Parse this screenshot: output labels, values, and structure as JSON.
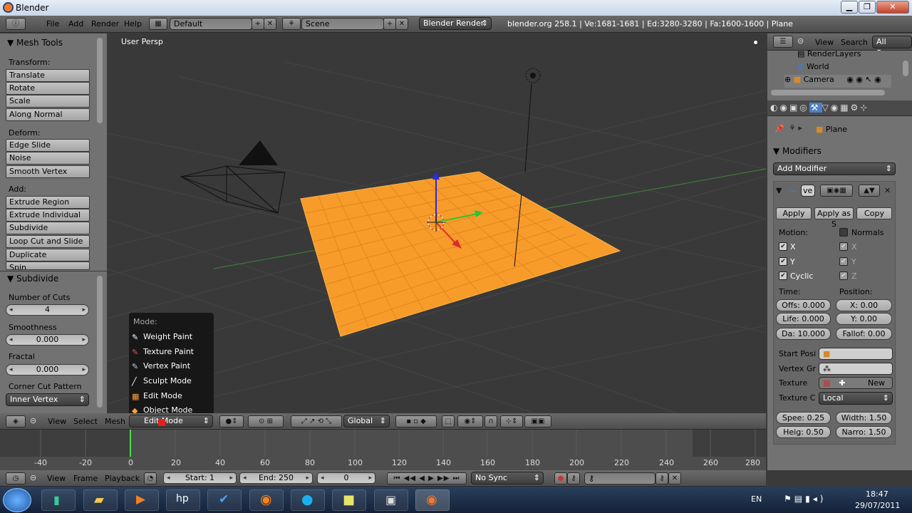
{
  "window": {
    "title": "Blender"
  },
  "topbar": {
    "menus": [
      "File",
      "Add",
      "Render",
      "Help"
    ],
    "layout": "Default",
    "scene": "Scene",
    "engine": "Blender Render",
    "stats": "blender.org 258.1 | Ve:1681-1681 | Ed:3280-3280 | Fa:1600-1600 | Plane"
  },
  "outliner": {
    "view": "View",
    "search": "Search",
    "filter": "All Scenes",
    "items": [
      "RenderLayers",
      "World",
      "Camera"
    ]
  },
  "toolshelf": {
    "title": "Mesh Tools",
    "transform_label": "Transform:",
    "transform": [
      "Translate",
      "Rotate",
      "Scale",
      "Along Normal"
    ],
    "deform_label": "Deform:",
    "deform": [
      "Edge Slide",
      "Noise",
      "Smooth Vertex"
    ],
    "add_label": "Add:",
    "add": [
      "Extrude Region",
      "Extrude Individual",
      "Subdivide",
      "Loop Cut and Slide",
      "Duplicate",
      "Spin"
    ]
  },
  "subdivide": {
    "title": "Subdivide",
    "cuts_label": "Number of Cuts",
    "cuts": "4",
    "smooth_label": "Smoothness",
    "smooth": "0.000",
    "fractal_label": "Fractal",
    "fractal": "0.000",
    "pattern_label": "Corner Cut Pattern",
    "pattern": "Inner Vertex"
  },
  "viewport": {
    "label": "User Persp"
  },
  "mode_menu": {
    "header": "Mode:",
    "items": [
      "Weight Paint",
      "Texture Paint",
      "Vertex Paint",
      "Sculpt Mode",
      "Edit Mode",
      "Object Mode"
    ]
  },
  "view3d_header": {
    "menus": [
      "View",
      "Select",
      "Mesh"
    ],
    "mode": "Edit Mode",
    "orientation": "Global"
  },
  "properties": {
    "object": "Plane",
    "modifiers_title": "Modifiers",
    "add_modifier": "Add Modifier",
    "mod_name": "ve",
    "apply": "Apply",
    "apply_as": "Apply as S",
    "copy": "Copy",
    "motion_label": "Motion:",
    "normals": "Normals",
    "x": "X",
    "y": "Y",
    "cyclic": "Cyclic",
    "gx": "X",
    "gy": "Y",
    "gz": "Z",
    "time_label": "Time:",
    "position_label": "Position:",
    "offs": "Offs: 0.000",
    "posx": "X: 0.00",
    "life": "Life: 0.000",
    "posy": "Y: 0.00",
    "da": "Da: 10.000",
    "falloff": "Fallof: 0.00",
    "start_pos": "Start Posi",
    "vertex_gr": "Vertex Gr",
    "texture": "Texture",
    "new": "New",
    "texture_c": "Texture C",
    "local": "Local",
    "speed": "Spee: 0.25",
    "width": "Width: 1.50",
    "height": "Heig: 0.50",
    "narrow": "Narro: 1.50"
  },
  "timeline": {
    "ticks": [
      "-40",
      "-20",
      "0",
      "20",
      "40",
      "60",
      "80",
      "100",
      "120",
      "140",
      "160",
      "180",
      "200",
      "220",
      "240",
      "260",
      "280"
    ],
    "menus": [
      "View",
      "Frame",
      "Playback"
    ],
    "start": "Start: 1",
    "end": "End: 250",
    "current": "0",
    "sync": "No Sync"
  },
  "taskbar": {
    "lang": "EN",
    "time": "18:47",
    "date": "29/07/2011"
  }
}
